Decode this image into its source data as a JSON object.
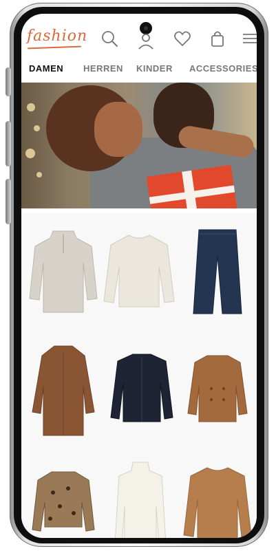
{
  "logo": {
    "text": "fashion"
  },
  "header_icons": [
    "search-icon",
    "user-icon",
    "heart-icon",
    "shopping-bag-icon",
    "menu-icon"
  ],
  "nav": {
    "tabs": [
      {
        "label": "DAMEN",
        "active": true
      },
      {
        "label": "HERREN",
        "active": false
      },
      {
        "label": "KINDER",
        "active": false
      },
      {
        "label": "ACCESSORIES",
        "active": false
      }
    ]
  },
  "colors": {
    "brand": "#d86a3a",
    "active_tab": "#111111",
    "inactive_tab": "#777777"
  },
  "products": [
    {
      "name": "beige-half-zip-sweater",
      "color": "#d8d3ca"
    },
    {
      "name": "cream-knit-sweater",
      "color": "#ece7dc"
    },
    {
      "name": "dark-blue-wide-jeans",
      "color": "#243552"
    },
    {
      "name": "brown-wool-coat",
      "color": "#8a5533"
    },
    {
      "name": "navy-shirt-jacket",
      "color": "#1e2433"
    },
    {
      "name": "camel-peacoat",
      "color": "#a36a3e"
    },
    {
      "name": "leopard-print-jacket",
      "color": "#9a7a56"
    },
    {
      "name": "white-turtleneck-top",
      "color": "#f3f1e8"
    },
    {
      "name": "camel-knit-sweater",
      "color": "#b57e4c"
    }
  ]
}
